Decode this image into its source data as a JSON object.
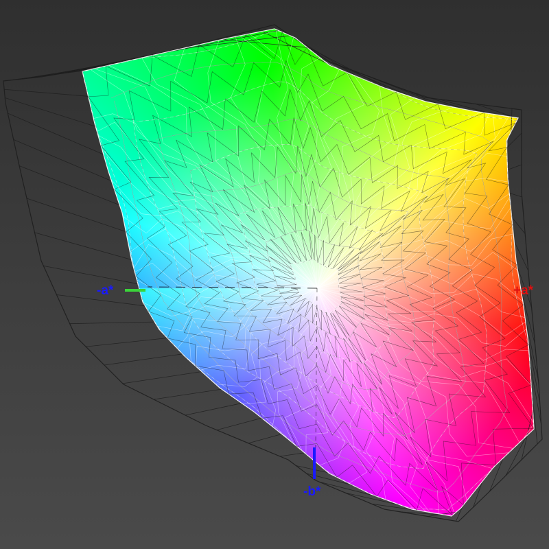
{
  "axes": {
    "neg_a": {
      "label": "-a*",
      "color": "#1a1aff"
    },
    "pos_a": {
      "label": "+a*",
      "color": "#e01010"
    },
    "neg_b": {
      "label": "-b*",
      "color": "#1a1aff"
    }
  },
  "colors": {
    "background": "#3a3a3a",
    "reference_wireframe": "#1e1e1e",
    "measured_wireframe": "#ffffff",
    "neg_a_marker": "#3ad43a",
    "neg_b_marker": "#1a1aff"
  }
}
